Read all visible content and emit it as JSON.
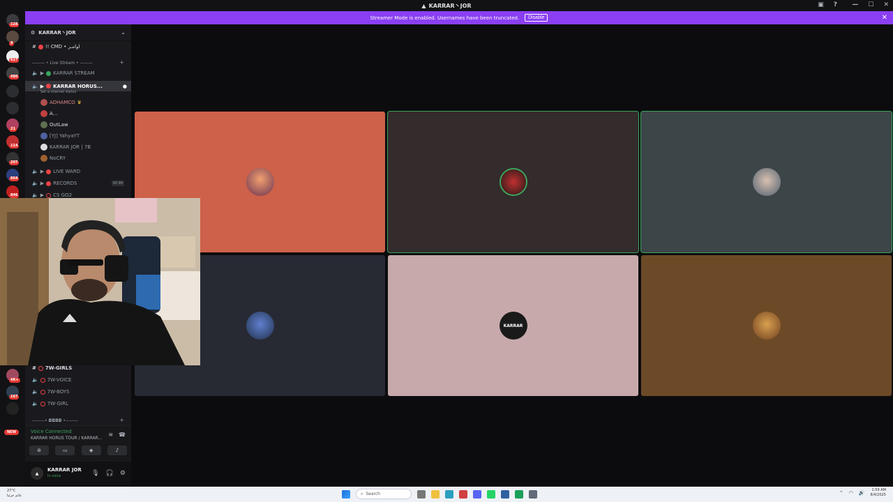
{
  "window": {
    "title": "KARRAR丶JOR"
  },
  "banner": {
    "text": "Streamer Mode is enabled. Usernames have been truncated.",
    "disable_label": "Disable"
  },
  "server_badges": [
    "128",
    "9",
    "627",
    "480",
    "21",
    "114",
    "207",
    "864",
    "846",
    "4K+",
    "167"
  ],
  "new_label": "NEW",
  "guild": {
    "name": "KARRAR丶JOR"
  },
  "channels": {
    "cmd": "!! CMD • اوامـر",
    "category_live": "——— • Live Stream • ———",
    "live_stream": "KARRAR STREAM",
    "horus": "KARRAR HORUS...",
    "horus_status": "Set a channel status",
    "members": [
      "ADHAMCO",
      "A...",
      "OutLaw",
      "[YJ] YahyaYT",
      "KARRAR JOR | 7B",
      "NoCRY"
    ],
    "live_ward": "LIVE WARD",
    "records": "RECORDS",
    "records_count": "00 99",
    "csgo": "CS GO2",
    "girls": "7W-GIRLS",
    "voice": "7W-VOICE",
    "boys": "7W-BOYS",
    "girl": "7W-GIRL",
    "category_bottom": "———• ◘◘◘◘ •———"
  },
  "voice_panel": {
    "status": "Voice Connected",
    "channel": "KARRAR HORUS TOUR / KARRAR..."
  },
  "user": {
    "name": "KARRAR JOR",
    "status": "In voice"
  },
  "tiles": [
    {
      "bg": "#cd614a",
      "label": "",
      "speaking": false
    },
    {
      "bg": "#332b2c",
      "label": "",
      "speaking": true
    },
    {
      "bg": "#3c4548",
      "label": "",
      "speaking": true
    },
    {
      "bg": "#272a33",
      "label": "",
      "speaking": false
    },
    {
      "bg": "#c7a9ab",
      "label": "KARRAR",
      "speaking": false
    },
    {
      "bg": "#6d4a27",
      "label": "",
      "speaking": false
    }
  ],
  "taskbar": {
    "weather_temp": "27°C",
    "weather_desc": "غائم جزئيا",
    "search_placeholder": "Search",
    "time": "1:59 AM",
    "date": "8/4/2025"
  },
  "colors": {
    "accent_purple": "#8a3ff2",
    "voice_green": "#3ba55d",
    "live_red": "#ed4245"
  }
}
